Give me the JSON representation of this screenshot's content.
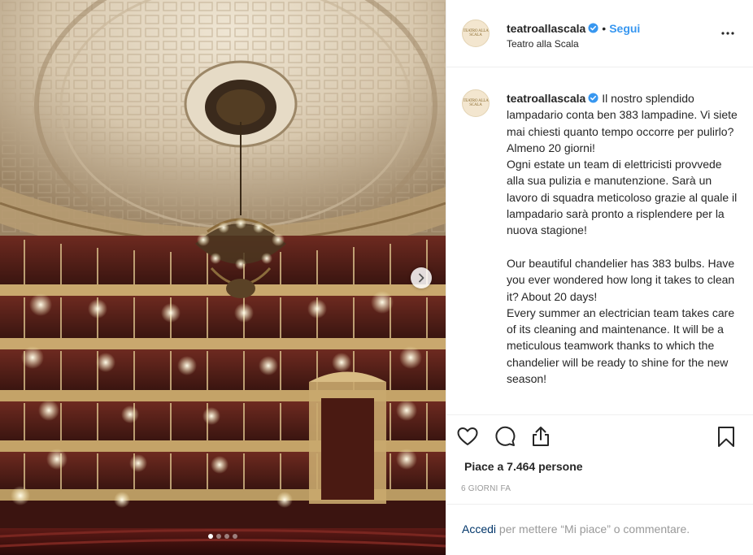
{
  "post": {
    "username": "teatroallascala",
    "location": "Teatro alla Scala",
    "follow_label": "Segui",
    "bullet": "•",
    "avatar_logo_text": "TEATRO ALLA SCALA",
    "caption_text": "Il nostro splendido lampadario conta ben 383 lampadine. Vi siete mai chiesti quanto tempo occorre per pulirlo? Almeno 20 giorni!\nOgni estate un team di elettricisti provvede alla sua pulizia e manutenzione. Sarà un lavoro di squadra meticoloso grazie al quale il lampadario sarà pronto a risplendere per la nuova stagione!\n\nOur beautiful chandelier has 383 bulbs. Have you ever wondered how long it takes to clean it? About 20 days!\nEvery summer an electrician team takes care of its cleaning and maintenance. It will be a meticulous teamwork thanks to which the chandelier will be ready to shine for the new season!",
    "likes_text": "Piace a 7.464 persone",
    "timestamp": "6 giorni fa",
    "login_link": "Accedi",
    "login_rest": " per mettere “Mi piace” o commentare."
  },
  "carousel": {
    "slide_count": 4,
    "active_index": 0
  },
  "icons": {
    "verified": "verified-badge-icon",
    "more": "more-options-icon",
    "like": "heart-icon",
    "comment": "comment-icon",
    "share": "share-icon",
    "save": "bookmark-icon",
    "next": "chevron-right-icon"
  },
  "colors": {
    "follow": "#3897f0",
    "verified": "#3897f0",
    "text": "#262626",
    "muted": "#999999",
    "login_link": "#003569"
  }
}
